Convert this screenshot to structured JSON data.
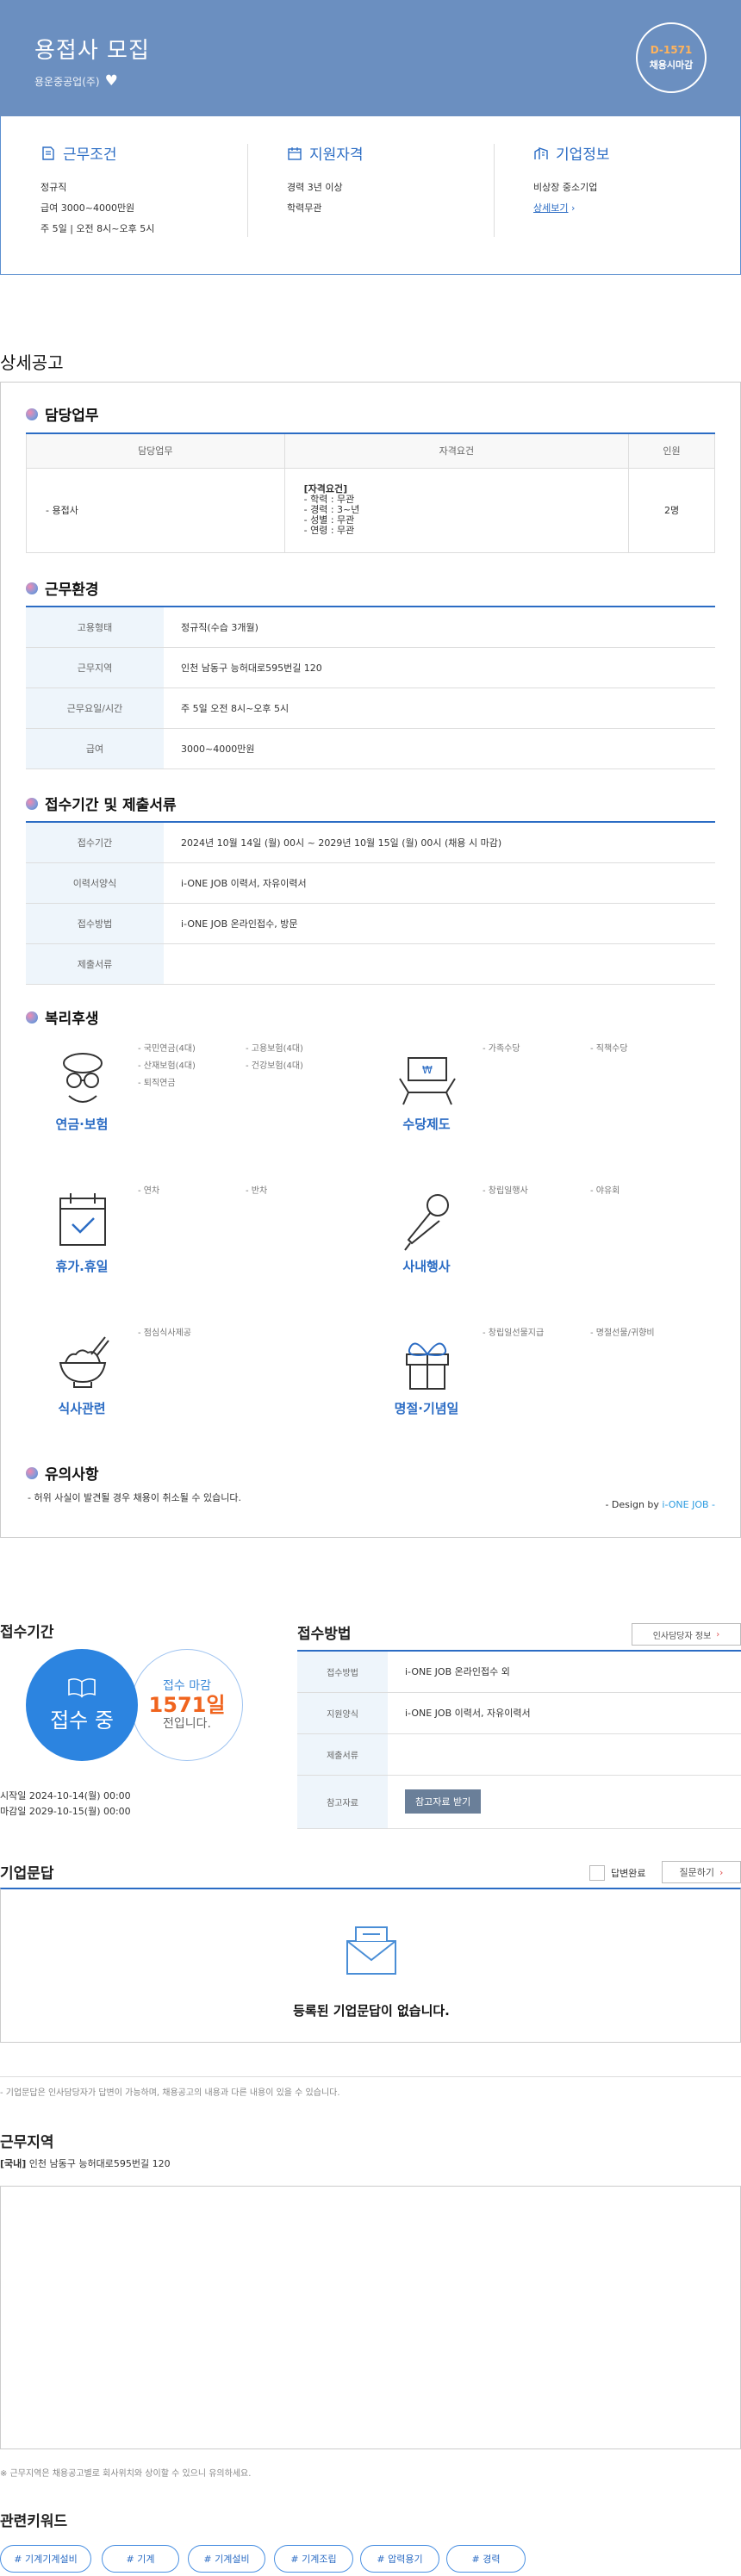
{
  "header": {
    "title": "용접사 모집",
    "company": "용운중공업(주)",
    "dday": "D-1571",
    "dday_sub": "채용시마감"
  },
  "summary": {
    "conditions": {
      "heading": "근무조건",
      "lines": [
        "정규직",
        "급여 3000~4000만원",
        "주 5일 | 오전 8시~오후 5시"
      ]
    },
    "qualifications": {
      "heading": "지원자격",
      "lines": [
        "경력 3년 이상",
        "학력무관"
      ]
    },
    "company": {
      "heading": "기업정보",
      "lines": [
        "비상장 중소기업"
      ],
      "more": "상세보기"
    }
  },
  "detail": {
    "title": "상세공고",
    "duties": {
      "heading": "담당업무",
      "columns": [
        "담당업무",
        "자격요건",
        "인원"
      ],
      "row": {
        "duty": "- 용접사",
        "req_title": "[자격요건]",
        "reqs": [
          "- 학력 : 무관",
          "- 경력 : 3~년",
          "- 성별 : 무관",
          "- 연령 : 무관"
        ],
        "count": "2명"
      }
    },
    "environment": {
      "heading": "근무환경",
      "rows": [
        {
          "k": "고용형태",
          "v": "정규직(수습 3개월)"
        },
        {
          "k": "근무지역",
          "v": "인천 남동구 능허대로595번길 120"
        },
        {
          "k": "근무요일/시간",
          "v": "주 5일 오전 8시~오후 5시"
        },
        {
          "k": "급여",
          "v": "3000~4000만원"
        }
      ]
    },
    "application": {
      "heading": "접수기간 및 제출서류",
      "rows": [
        {
          "k": "접수기간",
          "v": "2024년 10월 14일 (월) 00시 ~ 2029년 10월 15일 (월) 00시 (채용 시 마감)"
        },
        {
          "k": "이력서양식",
          "v": "i-ONE JOB 이력서, 자유이력서"
        },
        {
          "k": "접수방법",
          "v": "i-ONE JOB 온라인접수, 방문"
        },
        {
          "k": "제출서류",
          "v": ""
        }
      ]
    },
    "welfare": {
      "heading": "복리후생",
      "pension": {
        "name": "연금·보험",
        "items": [
          "- 국민연금(4대)",
          "- 고용보험(4대)",
          "- 산재보험(4대)",
          "- 건강보험(4대)",
          "- 퇴직연금"
        ]
      },
      "allowance": {
        "name": "수당제도",
        "items": [
          "- 가족수당",
          "- 직책수당"
        ]
      },
      "vacation": {
        "name": "휴가.휴일",
        "items": [
          "- 연차",
          "- 반차"
        ]
      },
      "event": {
        "name": "사내행사",
        "items": [
          "- 창립일행사",
          "- 야유회"
        ]
      },
      "meal": {
        "name": "식사관련",
        "items": [
          "- 점심식사제공"
        ]
      },
      "holiday": {
        "name": "명절·기념일",
        "items": [
          "- 창립일선물지급",
          "- 명절선물/귀향비"
        ]
      }
    },
    "notice": {
      "heading": "유의사항",
      "text": "- 허위 사실이 발견될 경우 채용이 취소될 수 있습니다."
    },
    "design": {
      "prefix": "- Design by ",
      "brand": "i-ONE JOB -"
    }
  },
  "period": {
    "title": "접수기간",
    "status": "접수 중",
    "deadline_label": "접수 마감",
    "deadline_days": "1571일",
    "deadline_suffix": "전입니다.",
    "start": "시작일 2024-10-14(월) 00:00",
    "end": "마감일 2029-10-15(월) 00:00"
  },
  "method": {
    "title": "접수방법",
    "hr_button": "인사담당자 정보",
    "rows": [
      {
        "k": "접수방법",
        "v": "i-ONE JOB 온라인접수 외"
      },
      {
        "k": "지원양식",
        "v": "i-ONE JOB 이력서, 자유이력서"
      },
      {
        "k": "제출서류",
        "v": ""
      }
    ],
    "ref_label": "참고자료",
    "ref_button": "참고자료 받기"
  },
  "qna": {
    "title": "기업문답",
    "checkbox_label": "답변완료",
    "ask_button": "질문하기",
    "empty": "등록된 기업문답이 없습니다.",
    "note": "- 기업문답은 인사담당자가 답변이 가능하며, 채용공고의 내용과 다른 내용이 있을 수 있습니다."
  },
  "location": {
    "title": "근무지역",
    "tag": "[국내]",
    "address": " 인천 남동구 능허대로595번길 120",
    "note": "※ 근무지역은 채용공고별로 회사위치와 상이할 수 있으니 유의하세요."
  },
  "keywords": {
    "title": "관련키워드",
    "items": [
      "# 기계기계설비",
      "# 기계",
      "# 기계설비",
      "# 기계조립",
      "# 압력용기",
      "# 경력"
    ]
  },
  "colors": {
    "header_bg": "#6b8fc0",
    "accent": "#2b6cc4",
    "deadline": "#f0641e",
    "status_circle": "#2c84e0"
  }
}
